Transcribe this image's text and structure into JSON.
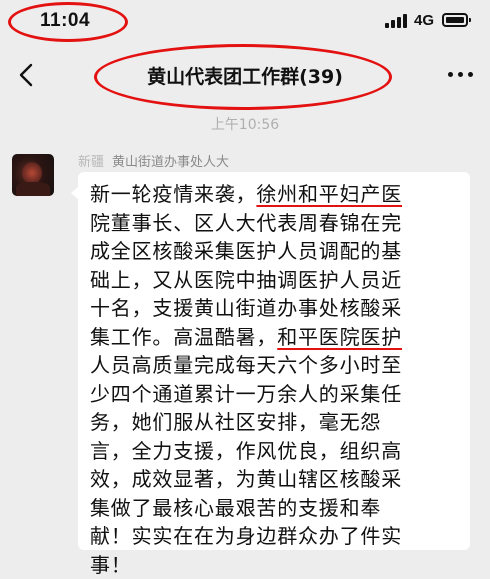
{
  "status_bar": {
    "time": "11:04",
    "network": "4G",
    "annotation_color": "#e41111"
  },
  "header": {
    "title": "黄山代表团工作群(39)",
    "back_icon": "chevron-left-icon",
    "more_icon": "ellipsis-icon"
  },
  "chat": {
    "timestamp": "上午10:56",
    "messages": [
      {
        "sender_blurred": "新疆",
        "sender_name": "黄山街道办事处人大",
        "lines": [
          [
            {
              "t": "新一轮疫情来袭，"
            },
            {
              "t": "徐州和平妇产医",
              "hl": true
            }
          ],
          [
            {
              "t": "院董事长、区人大代表周春锦在完"
            }
          ],
          [
            {
              "t": "成全区核酸采集医护人员调配的基"
            }
          ],
          [
            {
              "t": "础上，又从医院中抽调医护人员近"
            }
          ],
          [
            {
              "t": "十名，支援黄山街道办事处核酸采"
            }
          ],
          [
            {
              "t": "集工作。高温酷暑，"
            },
            {
              "t": "和平医院医护",
              "hl": true
            }
          ],
          [
            {
              "t": "人员高质量完成每天六个多小时至"
            }
          ],
          [
            {
              "t": "少四个通道累计一万余人的采集任"
            }
          ],
          [
            {
              "t": "务，她们服从社区安排，毫无怨"
            }
          ],
          [
            {
              "t": "言，全力支援，作风优良，组织高"
            }
          ],
          [
            {
              "t": "效，成效显著，为黄山辖区核酸采"
            }
          ],
          [
            {
              "t": "集做了最核心最艰苦的支援和奉"
            }
          ],
          [
            {
              "t": "献！实实在在为身边群众办了件实"
            }
          ],
          [
            {
              "t": "事！"
            }
          ]
        ]
      }
    ]
  },
  "colors": {
    "background": "#ededed",
    "bubble": "#ffffff",
    "highlight_underline": "#e41111",
    "timestamp_text": "#b0b0b0",
    "sender_text": "#8a8a8a"
  }
}
